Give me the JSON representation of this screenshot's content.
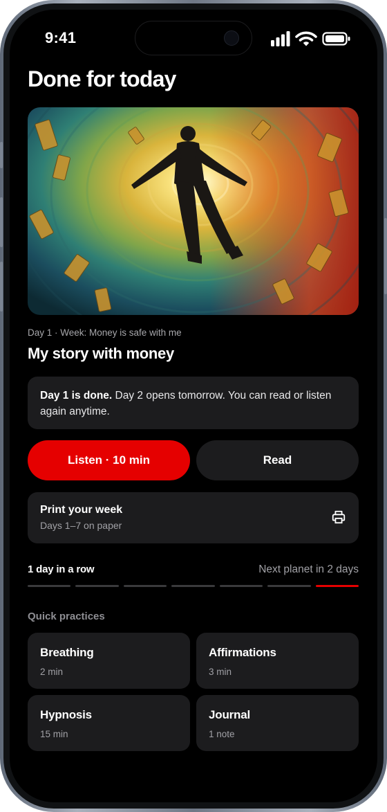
{
  "status_bar": {
    "time": "9:41"
  },
  "page": {
    "title": "Done for today"
  },
  "story": {
    "meta": "Day 1 · Week: Money is safe with me",
    "title": "My story with money"
  },
  "notice": {
    "bold": "Day 1 is done.",
    "text": " Day 2 opens tomorrow. You can read or listen again anytime."
  },
  "actions": {
    "listen_label": "Listen · 10 min",
    "read_label": "Read"
  },
  "print_card": {
    "title": "Print your week",
    "subtitle": "Days 1–7 on paper",
    "icon": "printer-icon"
  },
  "progress": {
    "streak_label": "1 day in a row",
    "next_label": "Next planet in 2 days",
    "days_total": 7,
    "active_day": 7
  },
  "quick": {
    "label": "Quick practices",
    "items": [
      {
        "name": "Breathing",
        "sub": "2 min"
      },
      {
        "name": "Affirmations",
        "sub": "3 min"
      },
      {
        "name": "Hypnosis",
        "sub": "15 min"
      },
      {
        "name": "Journal",
        "sub": "1 note"
      }
    ]
  },
  "colors": {
    "accent": "#e50000",
    "background": "#000000",
    "card": "#1c1c1e",
    "muted_text": "#a1a1a6"
  }
}
